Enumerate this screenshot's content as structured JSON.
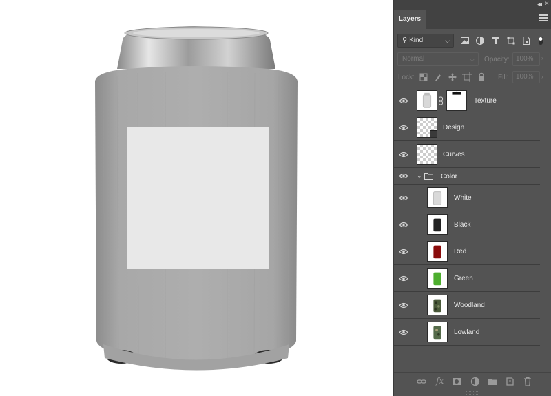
{
  "panel": {
    "tab_label": "Layers",
    "collapse_icon": "double-chevron-icon",
    "close_icon": "close-icon",
    "menu_icon": "menu-icon"
  },
  "filter": {
    "kind_label": "Kind",
    "icons": [
      "image-filter-icon",
      "adjustment-filter-icon",
      "type-filter-icon",
      "shape-filter-icon",
      "smart-object-filter-icon",
      "filter-toggle-icon"
    ]
  },
  "blend": {
    "mode": "Normal",
    "opacity_label": "Opacity:",
    "opacity_value": "100%"
  },
  "lock": {
    "label": "Lock:",
    "icons": [
      "lock-transparent-icon",
      "lock-image-icon",
      "lock-position-icon",
      "lock-artboard-icon",
      "lock-all-icon"
    ],
    "fill_label": "Fill:",
    "fill_value": "100%"
  },
  "layers": [
    {
      "name": "Texture",
      "type": "masked",
      "thumb_color": "#d8d8d8"
    },
    {
      "name": "Design",
      "type": "smart",
      "thumb_color": "transparent"
    },
    {
      "name": "Curves",
      "type": "pixel",
      "thumb_color": "transparent"
    },
    {
      "name": "Color",
      "type": "group"
    },
    {
      "name": "White",
      "type": "pixel",
      "thumb_color": "#d9d9d9"
    },
    {
      "name": "Black",
      "type": "pixel",
      "thumb_color": "#222222"
    },
    {
      "name": "Red",
      "type": "pixel",
      "thumb_color": "#8a0b0b"
    },
    {
      "name": "Green",
      "type": "pixel",
      "thumb_color": "#4dae2e"
    },
    {
      "name": "Woodland",
      "type": "pixel",
      "thumb_color": "#4a5a3a"
    },
    {
      "name": "Lowland",
      "type": "pixel",
      "thumb_color": "#556b4a"
    }
  ],
  "bottom_icons": [
    "link-layers-icon",
    "fx-icon",
    "add-mask-icon",
    "new-adjustment-icon",
    "new-group-icon",
    "new-layer-icon",
    "delete-layer-icon"
  ],
  "fx_label": "fx"
}
